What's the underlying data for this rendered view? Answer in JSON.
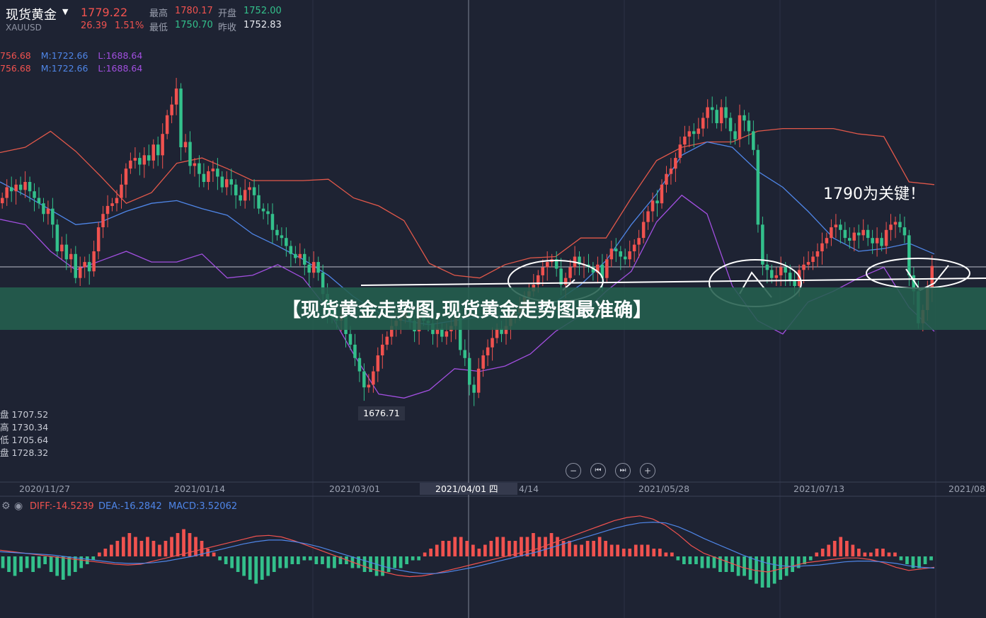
{
  "header": {
    "name": "现货黄金",
    "code": "XAUUSD",
    "price": "1779.22",
    "change": "26.39",
    "change_pct": "1.51%",
    "high_label": "最高",
    "high": "1780.17",
    "open_label": "开盘",
    "open": "1752.00",
    "low_label": "最低",
    "low": "1750.70",
    "prev_label": "昨收",
    "prev_close": "1752.83"
  },
  "bollinger": {
    "row1": {
      "upper": "756.68",
      "mid": "M:1722.66",
      "lower": "L:1688.64"
    },
    "row2": {
      "upper": "756.68",
      "mid": "M:1722.66",
      "lower": "L:1688.64"
    }
  },
  "side_ohlc": {
    "open": "盘 1707.52",
    "high": "高 1730.34",
    "low": "低 1705.64",
    "close": "盘 1728.32"
  },
  "low_marker": "1676.71",
  "annotation": "1790为关键！",
  "banner": "【现货黄金走势图,现货黄金走势图最准确】",
  "x_axis": {
    "dates": [
      "2020/11/27",
      "2021/01/14",
      "2021/03/01",
      "4/14",
      "2021/05/28",
      "2021/07/13",
      "2021/08"
    ],
    "cursor_date": "2021/04/01 四"
  },
  "controls": {
    "zoom_out": "−",
    "prev": "⏮",
    "next": "⏭",
    "zoom_in": "+"
  },
  "macd": {
    "diff": "DIFF:-14.5239",
    "dea": "DEA:-16.2842",
    "macd": "MACD:3.52062"
  },
  "colors": {
    "up": "#f0524f",
    "down": "#33c08b",
    "upper_band": "#e2584a",
    "mid_band": "#4f86e8",
    "lower_band": "#a24fe0",
    "background": "#1e2333"
  },
  "chart_data": {
    "type": "line",
    "title": "现货黄金",
    "closes": [
      1830,
      1838,
      1835,
      1840,
      1836,
      1842,
      1835,
      1830,
      1826,
      1818,
      1822,
      1810,
      1790,
      1795,
      1784,
      1788,
      1770,
      1778,
      1782,
      1775,
      1790,
      1808,
      1818,
      1824,
      1826,
      1830,
      1840,
      1852,
      1858,
      1860,
      1855,
      1862,
      1858,
      1870,
      1862,
      1878,
      1892,
      1900,
      1912,
      1868,
      1872,
      1854,
      1856,
      1848,
      1842,
      1850,
      1852,
      1846,
      1838,
      1844,
      1840,
      1832,
      1828,
      1836,
      1838,
      1832,
      1822,
      1820,
      1818,
      1806,
      1802,
      1800,
      1794,
      1788,
      1785,
      1788,
      1780,
      1774,
      1782,
      1774,
      1758,
      1746,
      1740,
      1738,
      1742,
      1728,
      1720,
      1710,
      1700,
      1688,
      1690,
      1700,
      1712,
      1720,
      1726,
      1734,
      1738,
      1740,
      1745,
      1738,
      1730,
      1742,
      1738,
      1736,
      1728,
      1732,
      1726,
      1730,
      1734,
      1740,
      1716,
      1710,
      1690,
      1684,
      1702,
      1712,
      1718,
      1725,
      1732,
      1728,
      1734,
      1740,
      1744,
      1748,
      1756,
      1760,
      1765,
      1772,
      1778,
      1782,
      1784,
      1777,
      1765,
      1770,
      1778,
      1786,
      1780,
      1780,
      1778,
      1774,
      1780,
      1770,
      1784,
      1792,
      1790,
      1786,
      1784,
      1790,
      1795,
      1800,
      1812,
      1820,
      1828,
      1826,
      1840,
      1848,
      1852,
      1860,
      1870,
      1876,
      1880,
      1878,
      1882,
      1890,
      1898,
      1896,
      1886,
      1898,
      1890,
      1880,
      1874,
      1892,
      1888,
      1880,
      1866,
      1810,
      1780,
      1776,
      1770,
      1772,
      1778,
      1774,
      1768,
      1764,
      1776,
      1780,
      1782,
      1786,
      1790,
      1796,
      1800,
      1808,
      1810,
      1806,
      1800,
      1798,
      1804,
      1802,
      1806,
      1800,
      1796,
      1800,
      1794,
      1806,
      1810,
      1812,
      1808,
      1802,
      1772,
      1760,
      1736,
      1746,
      1762,
      1779
    ],
    "upper_band_values": [
      1864,
      1868,
      1880,
      1865,
      1846,
      1826,
      1834,
      1856,
      1860,
      1852,
      1843,
      1843,
      1843,
      1844,
      1830,
      1824,
      1813,
      1781,
      1772,
      1770,
      1780,
      1785,
      1786,
      1800,
      1800,
      1830,
      1858,
      1868,
      1872,
      1872,
      1880,
      1882,
      1882,
      1882,
      1878,
      1876,
      1842,
      1840
    ],
    "mid_band_values": [
      1842,
      1832,
      1821,
      1810,
      1812,
      1820,
      1826,
      1828,
      1822,
      1817,
      1803,
      1794,
      1784,
      1772,
      1756,
      1744,
      1738,
      1735,
      1738,
      1741,
      1742,
      1745,
      1752,
      1765,
      1783,
      1810,
      1833,
      1862,
      1872,
      1868,
      1850,
      1838,
      1820,
      1800,
      1790,
      1792,
      1796,
      1788
    ],
    "lower_band_values": [
      1814,
      1810,
      1790,
      1776,
      1783,
      1790,
      1782,
      1782,
      1788,
      1770,
      1772,
      1780,
      1770,
      1746,
      1713,
      1683,
      1680,
      1686,
      1702,
      1700,
      1704,
      1713,
      1730,
      1742,
      1760,
      1775,
      1812,
      1832,
      1818,
      1764,
      1738,
      1728,
      1752,
      1760,
      1770,
      1778,
      1748,
      1730
    ],
    "ylim": [
      1660,
      1920
    ],
    "y_lines": [
      1793,
      1792
    ],
    "x_dates": [
      "2020/11/27",
      "2021/01/14",
      "2021/03/01",
      "2021/04/14",
      "2021/05/28",
      "2021/07/13",
      "2021/08"
    ],
    "low_point": 1676.71,
    "macd_histogram": [
      -3,
      -4,
      -5,
      -4,
      -3,
      -4,
      -3,
      -2,
      -4,
      -5,
      -6,
      -5,
      -4,
      -3,
      -2,
      -1,
      1,
      2,
      3,
      4,
      5,
      6,
      5,
      4,
      5,
      4,
      3,
      4,
      5,
      6,
      7,
      6,
      5,
      4,
      2,
      1,
      -1,
      -2,
      -3,
      -4,
      -5,
      -6,
      -7,
      -6,
      -5,
      -4,
      -3,
      -3,
      -2,
      -2,
      -1,
      -1,
      -2,
      -2,
      -3,
      -3,
      -2,
      -2,
      -3,
      -3,
      -4,
      -4,
      -5,
      -5,
      -4,
      -3,
      -3,
      -2,
      -1,
      -1,
      1,
      2,
      3,
      4,
      4,
      5,
      5,
      4,
      3,
      2,
      3,
      4,
      5,
      5,
      4,
      4,
      5,
      5,
      6,
      5,
      5,
      6,
      5,
      4,
      4,
      3,
      3,
      4,
      4,
      5,
      4,
      3,
      3,
      2,
      2,
      3,
      3,
      3,
      2,
      2,
      1,
      1,
      -1,
      -2,
      -2,
      -2,
      -3,
      -3,
      -3,
      -4,
      -4,
      -4,
      -5,
      -5,
      -6,
      -7,
      -8,
      -8,
      -7,
      -6,
      -5,
      -4,
      -3,
      -2,
      -1,
      1,
      2,
      3,
      4,
      5,
      4,
      3,
      2,
      1,
      1,
      2,
      2,
      1,
      1,
      -1,
      -2,
      -3,
      -3,
      -2,
      -1
    ],
    "macd_diff": [
      8,
      6,
      4,
      2,
      0,
      -2,
      -4,
      -6,
      -8,
      -10,
      -11,
      -10,
      -6,
      -2,
      2,
      6,
      10,
      14,
      18,
      22,
      26,
      27,
      25,
      20,
      14,
      8,
      2,
      -4,
      -10,
      -16,
      -20,
      -24,
      -26,
      -25,
      -22,
      -18,
      -14,
      -10,
      -6,
      -2,
      2,
      6,
      10,
      16,
      22,
      28,
      34,
      40,
      46,
      50,
      52,
      48,
      40,
      28,
      14,
      4,
      -2,
      -8,
      -14,
      -18,
      -20,
      -16,
      -12,
      -8,
      -6,
      -4,
      -2,
      -2,
      -4,
      -8,
      -14,
      -18,
      -16,
      -14
    ],
    "macd_dea": [
      6,
      5,
      4,
      3,
      2,
      0,
      -2,
      -4,
      -6,
      -8,
      -9,
      -9,
      -8,
      -6,
      -3,
      0,
      4,
      8,
      12,
      16,
      19,
      21,
      21,
      19,
      16,
      12,
      7,
      2,
      -3,
      -8,
      -13,
      -17,
      -20,
      -22,
      -22,
      -20,
      -17,
      -14,
      -10,
      -6,
      -2,
      2,
      6,
      11,
      16,
      21,
      26,
      31,
      36,
      40,
      43,
      44,
      43,
      38,
      31,
      23,
      16,
      9,
      2,
      -4,
      -9,
      -12,
      -13,
      -12,
      -11,
      -9,
      -7,
      -6,
      -6,
      -7,
      -9,
      -12,
      -14,
      -15
    ]
  }
}
